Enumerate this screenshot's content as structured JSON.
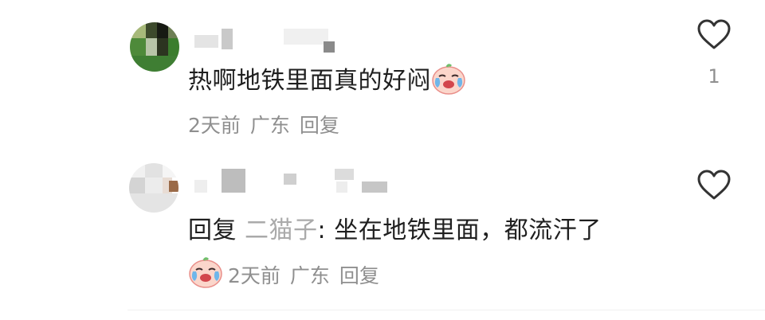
{
  "comments": [
    {
      "text": "热啊地铁里面真的好闷",
      "time": "2天前",
      "location": "广东",
      "reply_label": "回复",
      "like_count": "1",
      "emoji": "crying-face-emoji"
    },
    {
      "reply_prefix": "回复",
      "reply_to": "二猫子",
      "text": ": 坐在地铁里面，都流汗了",
      "time": "2天前",
      "location": "广东",
      "reply_label": "回复",
      "like_count": "",
      "emoji": "crying-face-emoji"
    }
  ],
  "colors": {
    "text": "#1f1f1f",
    "meta": "#8f8f8f",
    "reply_target": "#aaaaaa"
  }
}
